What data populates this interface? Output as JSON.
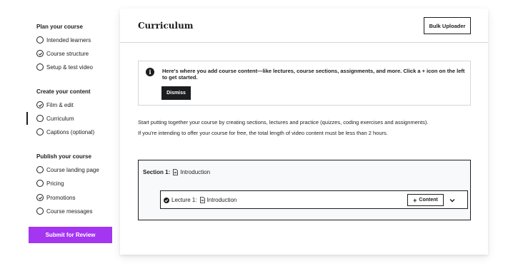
{
  "sidebar": {
    "groups": [
      {
        "title": "Plan your course",
        "items": [
          {
            "label": "Intended learners",
            "checked": false
          },
          {
            "label": "Course structure",
            "checked": true
          },
          {
            "label": "Setup & test video",
            "checked": false
          }
        ]
      },
      {
        "title": "Create your content",
        "items": [
          {
            "label": "Film & edit",
            "checked": true
          },
          {
            "label": "Curriculum",
            "checked": false,
            "active": true
          },
          {
            "label": "Captions (optional)",
            "checked": false
          }
        ]
      },
      {
        "title": "Publish your course",
        "items": [
          {
            "label": "Course landing page",
            "checked": false
          },
          {
            "label": "Pricing",
            "checked": false
          },
          {
            "label": "Promotions",
            "checked": true
          },
          {
            "label": "Course messages",
            "checked": false
          }
        ]
      }
    ],
    "submit_label": "Submit for Review"
  },
  "main": {
    "title": "Curriculum",
    "bulk_uploader_label": "Bulk Uploader",
    "info": {
      "icon": "i",
      "text": "Here's where you add course content—like lectures, course sections, assignments, and more. Click a + icon on the left to get started.",
      "dismiss_label": "Dismiss"
    },
    "paragraph1": "Start putting together your course by creating sections, lectures and practice (quizzes, coding exercises and assignments).",
    "paragraph2": "If you're intending to offer your course for free, the total length of video content must be less than 2 hours.",
    "section": {
      "label": "Section 1:",
      "name": "Introduction",
      "lecture": {
        "label": "Lecture 1:",
        "name": "Introduction",
        "content_button": "Content"
      }
    }
  },
  "colors": {
    "accent": "#a435f0",
    "text": "#1c1d1f",
    "border": "#d1d7dc",
    "section_bg": "#f7f9fa"
  }
}
